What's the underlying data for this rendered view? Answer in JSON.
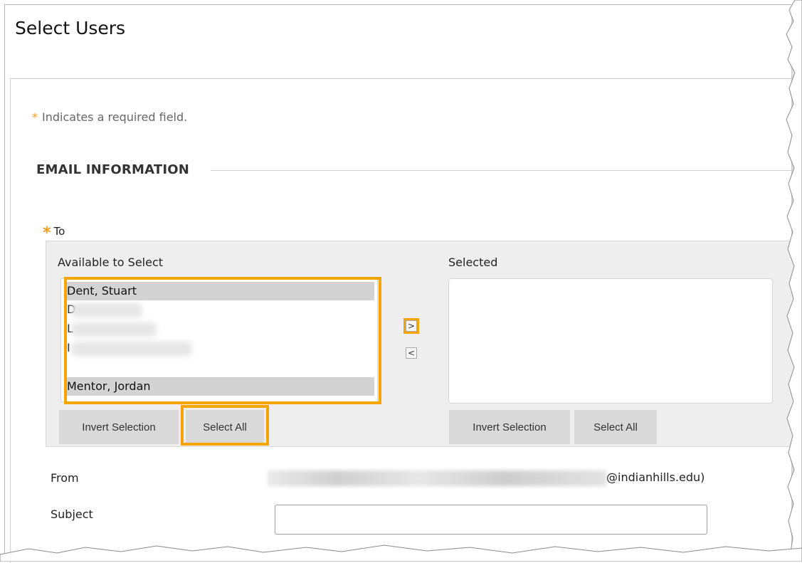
{
  "page": {
    "title": "Select Users"
  },
  "notice": {
    "star": "*",
    "text": "Indicates a required field."
  },
  "section": {
    "title": "EMAIL INFORMATION"
  },
  "to_field": {
    "star": "*",
    "label": "To",
    "available": {
      "title": "Available to Select",
      "items": [
        {
          "label": "Dent, Stuart",
          "selected": true
        },
        {
          "label": "D",
          "selected": false,
          "obscured": true
        },
        {
          "label": "L",
          "selected": false,
          "obscured": true
        },
        {
          "label": "I",
          "selected": false,
          "obscured": true
        },
        {
          "label": "Mentor, Jordan",
          "selected": true
        }
      ],
      "invert_label": "Invert Selection",
      "select_all_label": "Select All"
    },
    "move_right_icon": ">",
    "move_left_icon": "<",
    "selected": {
      "title": "Selected",
      "items": [],
      "invert_label": "Invert Selection",
      "select_all_label": "Select All"
    }
  },
  "from": {
    "label": "From",
    "value_suffix": "@indianhills.edu)"
  },
  "subject": {
    "label": "Subject",
    "value": "",
    "placeholder": ""
  },
  "colors": {
    "highlight": "#f6a400",
    "required": "#f19a18",
    "selection": "#d3d3d3"
  }
}
